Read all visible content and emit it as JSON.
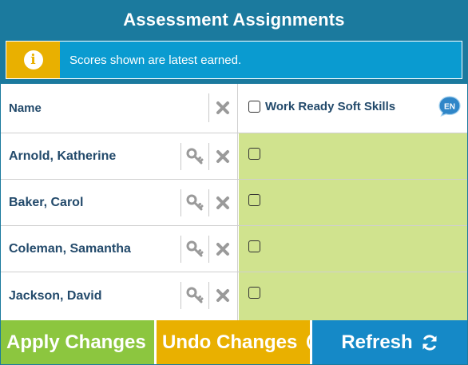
{
  "header": {
    "title": "Assessment Assignments"
  },
  "info": {
    "message": "Scores shown are latest earned.",
    "icon": "info-icon"
  },
  "table": {
    "name_header": "Name",
    "assessment_header": "Work Ready Soft Skills",
    "language_badge": "EN",
    "rows": [
      {
        "name": "Arnold, Katherine",
        "checked": false
      },
      {
        "name": "Baker, Carol",
        "checked": false
      },
      {
        "name": "Coleman, Samantha",
        "checked": false
      },
      {
        "name": "Jackson, David",
        "checked": false
      }
    ]
  },
  "footer": {
    "apply_label": "Apply Changes",
    "undo_label": "Undo Changes",
    "refresh_label": "Refresh"
  },
  "colors": {
    "header_bg": "#1b7a9e",
    "info_bg": "#0a9bd0",
    "info_icon_bg": "#e9b000",
    "cell_green": "#d0e38e",
    "apply_bg": "#8cc63f",
    "undo_bg": "#e9b000",
    "refresh_bg": "#1589c7",
    "name_text": "#234a6b"
  }
}
